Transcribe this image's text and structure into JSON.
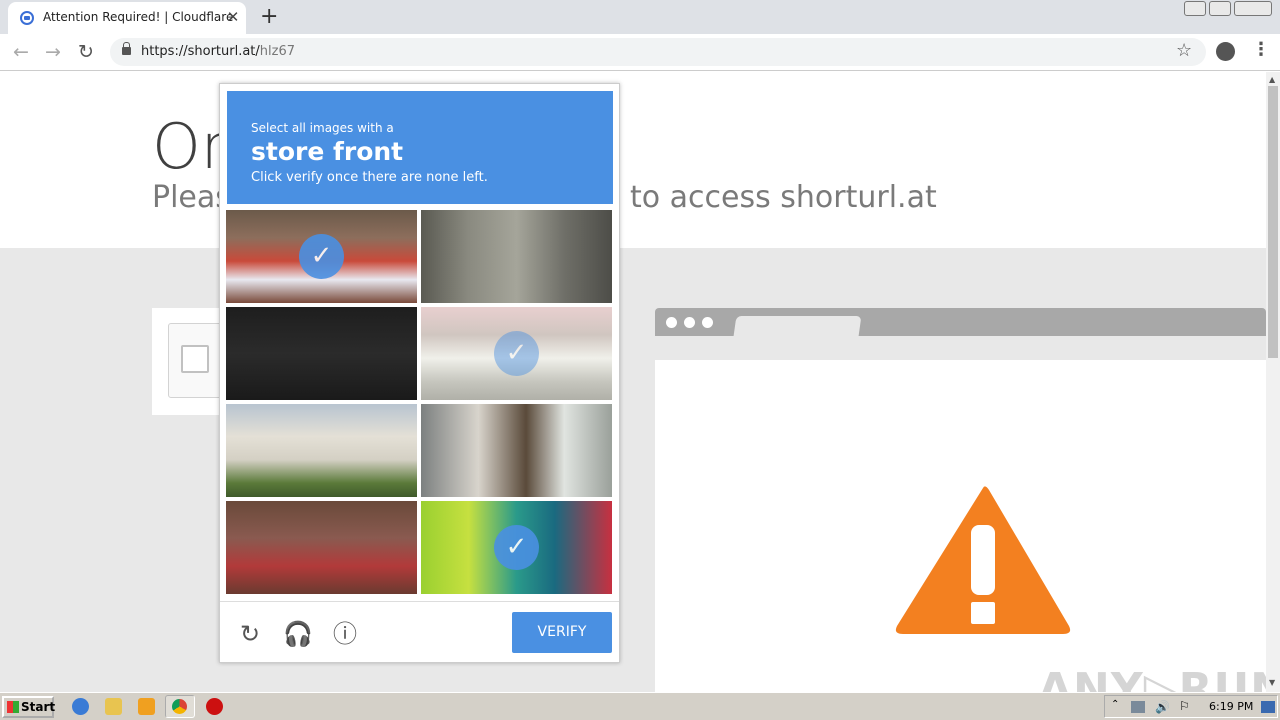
{
  "browser": {
    "tab_title": "Attention Required! | Cloudflare",
    "tab_close": "✕",
    "new_tab": "+",
    "back": "←",
    "forward": "→",
    "reload": "↻",
    "url_host": "https://shorturl.at/",
    "url_path": "hlz67",
    "bookmark_star": "☆",
    "menu": "⋮"
  },
  "page": {
    "heading": "On",
    "subheading": "Pleas",
    "subheading_tail": "to access shorturl.at",
    "watermark": "ANY▷RUN"
  },
  "challenge": {
    "instruction_line1": "Select all images with a",
    "target": "store front",
    "instruction_line3": "Click verify once there are none left.",
    "tiles": [
      {
        "selected": true
      },
      {
        "selected": false
      },
      {
        "selected": false
      },
      {
        "selected": true
      },
      {
        "selected": false
      },
      {
        "selected": false
      },
      {
        "selected": false
      },
      {
        "selected": true
      }
    ],
    "checkmark": "✓",
    "reload_icon": "↻",
    "audio_icon": "🎧",
    "info_icon": "ⓘ",
    "verify_label": "VERIFY"
  },
  "taskbar": {
    "start_label": "Start",
    "clock": "6:19 PM"
  }
}
